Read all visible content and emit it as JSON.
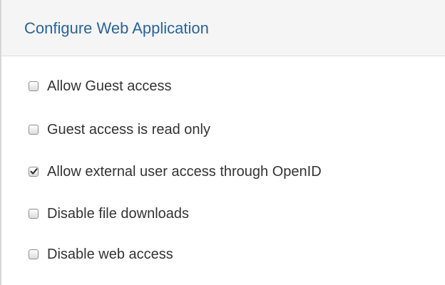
{
  "panel": {
    "title": "Configure Web Application",
    "options": [
      {
        "label": "Allow Guest access",
        "checked": false
      },
      {
        "label": "Guest access is read only",
        "checked": false
      },
      {
        "label": "Allow external user access through OpenID",
        "checked": true
      },
      {
        "label": "Disable file downloads",
        "checked": false
      },
      {
        "label": "Disable web access",
        "checked": false
      }
    ]
  },
  "colors": {
    "title": "#2a6496",
    "text": "#333333",
    "header_bg": "#f5f5f5",
    "border": "#d6d6d6"
  }
}
